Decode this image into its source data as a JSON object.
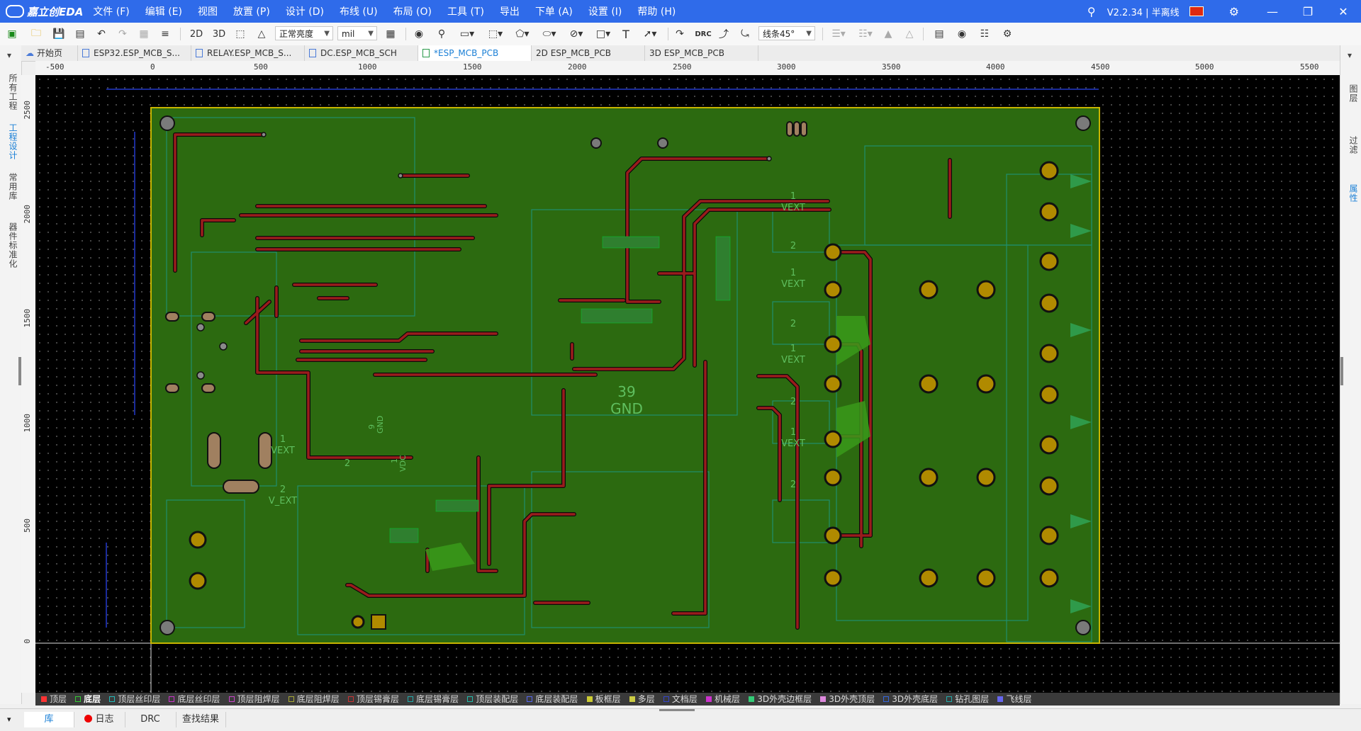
{
  "app": {
    "logo_text": "嘉立创EDA",
    "version_label": "V2.2.34 | 半离线"
  },
  "menu": [
    "文件 (F)",
    "编辑 (E)",
    "视图",
    "放置 (P)",
    "设计 (D)",
    "布线 (U)",
    "布局 (O)",
    "工具 (T)",
    "导出",
    "下单 (A)",
    "设置 (I)",
    "帮助 (H)"
  ],
  "toolbar": {
    "view_2d": "2D",
    "view_3d": "3D",
    "brightness_select": "正常亮度",
    "unit_select": "mil",
    "drc_label": "DRC",
    "route_mode_select": "线条45°"
  },
  "tabs": [
    {
      "label": "开始页"
    },
    {
      "label": "ESP32.ESP_MCB_S..."
    },
    {
      "label": "RELAY.ESP_MCB_S..."
    },
    {
      "label": "DC.ESP_MCB_SCH"
    },
    {
      "label": "*ESP_MCB_PCB"
    },
    {
      "label": "2D  ESP_MCB_PCB"
    },
    {
      "label": "3D  ESP_MCB_PCB"
    }
  ],
  "left_panel": [
    "所有工程",
    "工程设计",
    "常用库",
    "器件标准化"
  ],
  "right_panel": [
    "图层",
    "过滤",
    "属性"
  ],
  "ruler": {
    "h_labels": [
      "-500",
      "0",
      "500",
      "1000",
      "1500",
      "2000",
      "2500",
      "3000",
      "3500",
      "4000",
      "4500",
      "5000",
      "5500"
    ],
    "v_labels": [
      "2500",
      "2000",
      "1500",
      "1000",
      "500",
      "0"
    ]
  },
  "pcb_labels": {
    "gnd_net_number": "39",
    "gnd_net_name": "GND",
    "vext_1": "1",
    "vext": "VEXT",
    "pin_2": "2",
    "v_ext": "V_EXT",
    "gnd_9": "9",
    "gnd_small": "GND",
    "vdc": "VDC",
    "vdc_1": "1"
  },
  "layers": [
    {
      "name": "顶层",
      "color": "#ff3333"
    },
    {
      "name": "底层",
      "color": "#33cc33"
    },
    {
      "name": "顶层丝印层",
      "color": "#22bbbb"
    },
    {
      "name": "底层丝印层",
      "color": "#cc33cc"
    },
    {
      "name": "顶层阻焊层",
      "color": "#cc44cc"
    },
    {
      "name": "底层阻焊层",
      "color": "#aaaa33"
    },
    {
      "name": "顶层锡膏层",
      "color": "#cc3333"
    },
    {
      "name": "底层锡膏层",
      "color": "#22aaaa"
    },
    {
      "name": "顶层装配层",
      "color": "#22bbaa"
    },
    {
      "name": "底层装配层",
      "color": "#5566ee"
    },
    {
      "name": "板框层",
      "color": "#cccc33"
    },
    {
      "name": "多层",
      "color": "#cccc44"
    },
    {
      "name": "文档层",
      "color": "#3344cc"
    },
    {
      "name": "机械层",
      "color": "#cc33cc"
    },
    {
      "name": "3D外壳边框层",
      "color": "#33cc77"
    },
    {
      "name": "3D外壳顶层",
      "color": "#dd88dd"
    },
    {
      "name": "3D外壳底层",
      "color": "#3366dd"
    },
    {
      "name": "钻孔图层",
      "color": "#22aaaa"
    },
    {
      "name": "飞线层",
      "color": "#6666ee"
    }
  ],
  "bottom_tabs": [
    "库",
    "日志",
    "DRC",
    "查找结果"
  ],
  "colors": {
    "title_bar": "#2f6bea",
    "board_fill": "#2c6a10",
    "top_copper": "#b01818",
    "pad": "#c8a000",
    "canvas_bg": "#000000"
  }
}
